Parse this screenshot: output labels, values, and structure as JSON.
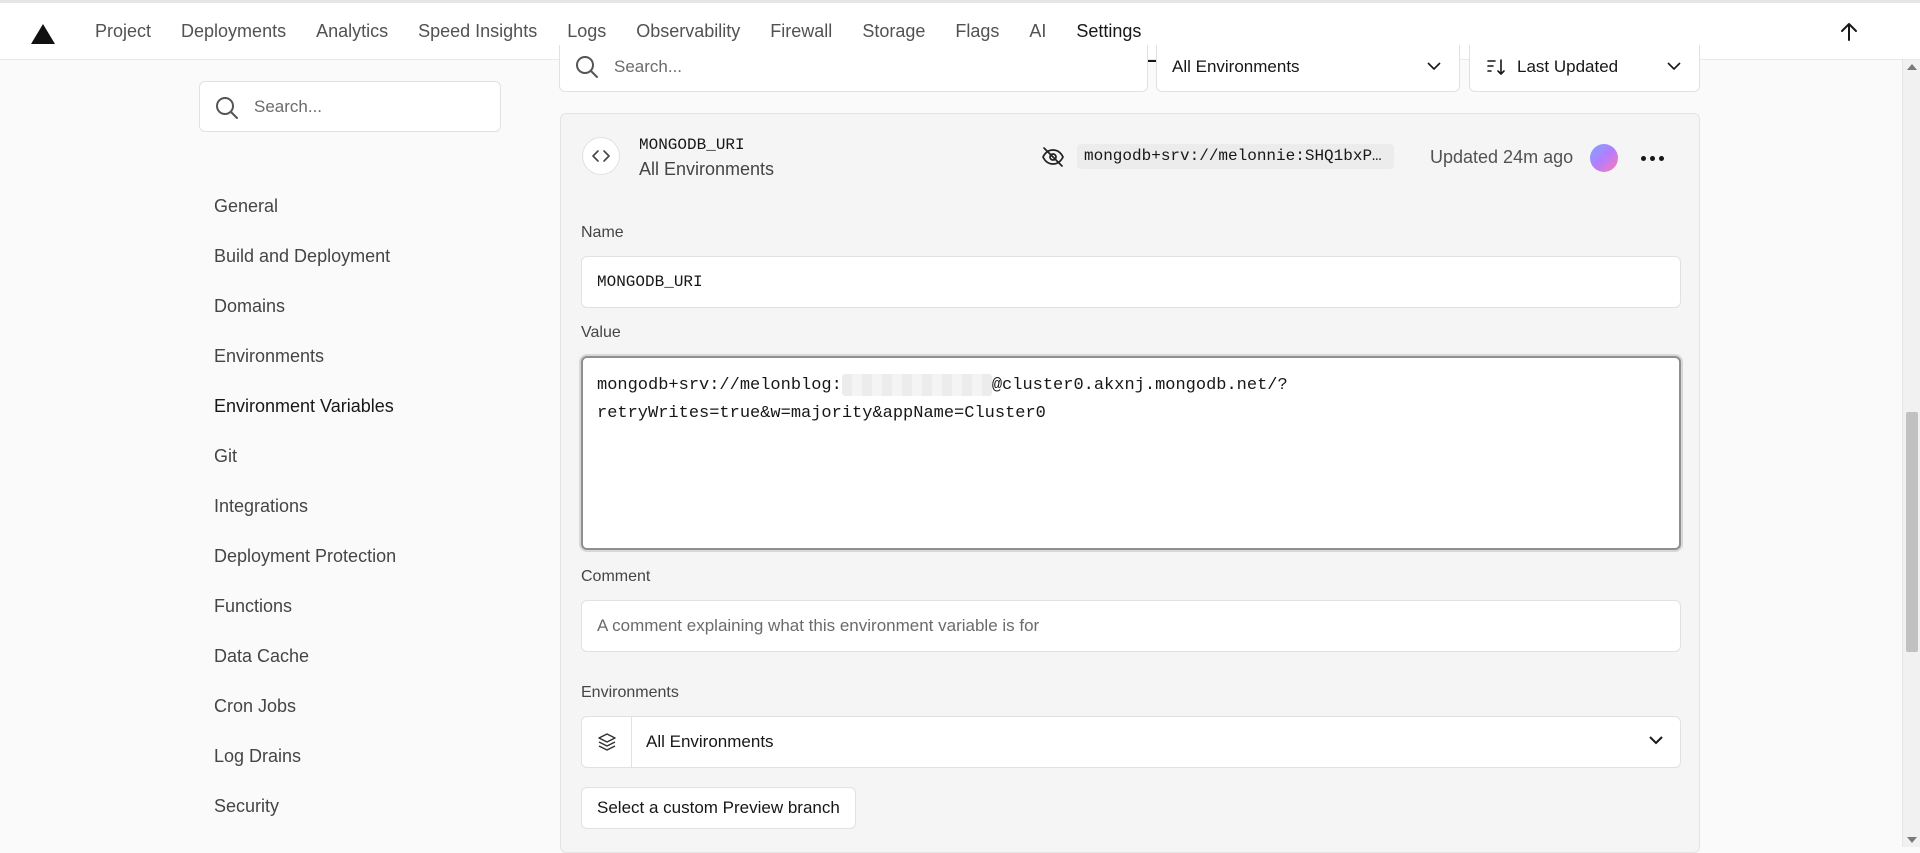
{
  "topnav": {
    "items": [
      {
        "label": "Project",
        "active": false
      },
      {
        "label": "Deployments",
        "active": false
      },
      {
        "label": "Analytics",
        "active": false
      },
      {
        "label": "Speed Insights",
        "active": false
      },
      {
        "label": "Logs",
        "active": false
      },
      {
        "label": "Observability",
        "active": false
      },
      {
        "label": "Firewall",
        "active": false
      },
      {
        "label": "Storage",
        "active": false
      },
      {
        "label": "Flags",
        "active": false
      },
      {
        "label": "AI",
        "active": false
      },
      {
        "label": "Settings",
        "active": true
      }
    ]
  },
  "sidebar": {
    "search_placeholder": "Search...",
    "items": [
      {
        "label": "General"
      },
      {
        "label": "Build and Deployment"
      },
      {
        "label": "Domains"
      },
      {
        "label": "Environments"
      },
      {
        "label": "Environment Variables",
        "active": true
      },
      {
        "label": "Git"
      },
      {
        "label": "Integrations"
      },
      {
        "label": "Deployment Protection"
      },
      {
        "label": "Functions"
      },
      {
        "label": "Data Cache"
      },
      {
        "label": "Cron Jobs"
      },
      {
        "label": "Log Drains"
      },
      {
        "label": "Security"
      }
    ]
  },
  "filters": {
    "search_placeholder": "Search...",
    "environment": "All Environments",
    "sort": "Last Updated"
  },
  "variable": {
    "name": "MONGODB_URI",
    "environments": "All Environments",
    "value_preview": "mongodb+srv://melonnie:SHQ1bxP…",
    "updated": "Updated 24m ago"
  },
  "form": {
    "name_label": "Name",
    "name_value": "MONGODB_URI",
    "value_label": "Value",
    "value_line1_a": "mongodb+srv://melonblog:",
    "value_line1_b": "@cluster0.akxnj.mongodb.net/?",
    "value_line2": "retryWrites=true&w=majority&appName=Cluster0",
    "comment_label": "Comment",
    "comment_placeholder": "A comment explaining what this environment variable is for",
    "environments_label": "Environments",
    "environments_value": "All Environments",
    "custom_branch_button": "Select a custom Preview branch"
  }
}
